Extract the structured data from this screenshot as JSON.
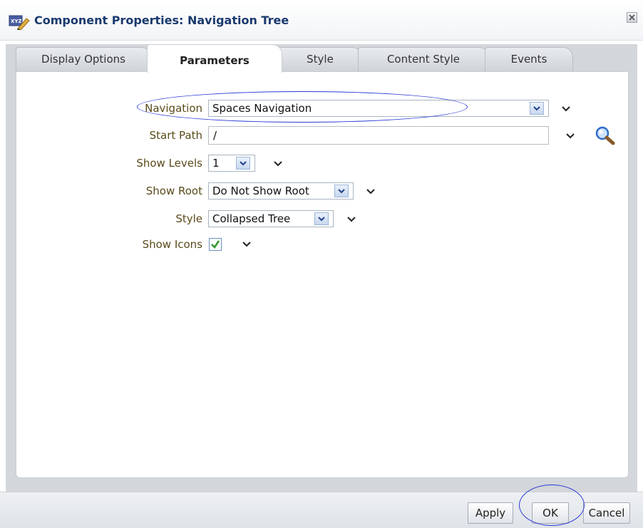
{
  "dialog": {
    "title": "Component Properties: Navigation Tree"
  },
  "tabs": [
    {
      "label": "Display Options",
      "active": false
    },
    {
      "label": "Parameters",
      "active": true
    },
    {
      "label": "Style",
      "active": false
    },
    {
      "label": "Content Style",
      "active": false
    },
    {
      "label": "Events",
      "active": false
    }
  ],
  "parameters": {
    "navigation": {
      "label": "Navigation",
      "value": "Spaces Navigation"
    },
    "start_path": {
      "label": "Start Path",
      "value": "/"
    },
    "show_levels": {
      "label": "Show Levels",
      "value": "1"
    },
    "show_root": {
      "label": "Show Root",
      "value": "Do Not Show Root"
    },
    "style": {
      "label": "Style",
      "value": "Collapsed Tree"
    },
    "show_icons": {
      "label": "Show Icons",
      "checked": true
    }
  },
  "buttons": {
    "apply": "Apply",
    "ok": "OK",
    "cancel": "Cancel"
  },
  "icons": {
    "title": "edit-properties-icon",
    "close": "close-icon",
    "dropdown": "chevron-down-icon",
    "search": "search-icon"
  },
  "colors": {
    "annotation_ellipse": "#2a3bd6",
    "title_text": "#1a3a6e",
    "field_label": "#5a4a1a"
  }
}
